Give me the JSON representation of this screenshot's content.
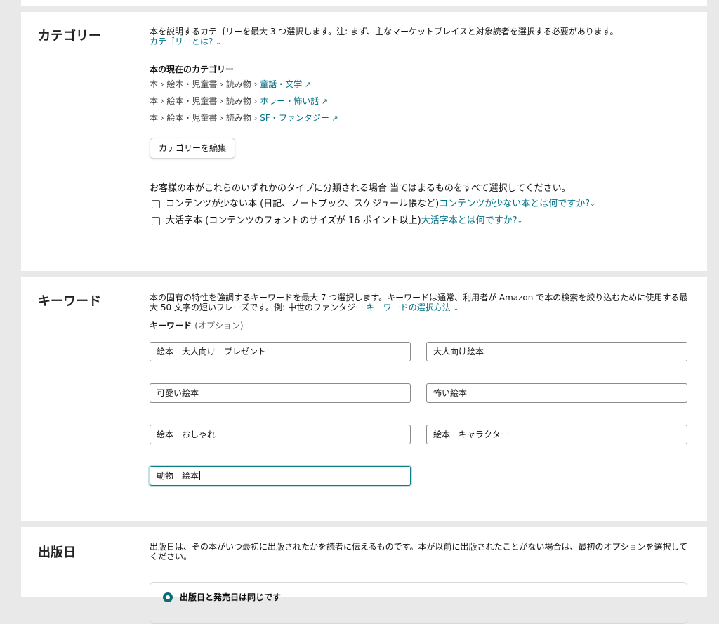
{
  "category": {
    "title": "カテゴリー",
    "description": "本を説明するカテゴリーを最大 3 つ選択します。注: まず、主なマーケットプレイスと対象読者を選択する必要があります。",
    "help_link": "カテゴリーとは?",
    "current_title": "本の現在のカテゴリー",
    "crumb_prefix": "本 › 絵本・児童書 › 読み物 › ",
    "items": [
      {
        "leaf": "童話・文学"
      },
      {
        "leaf": "ホラー・怖い話"
      },
      {
        "leaf": "SF・ファンタジー"
      }
    ],
    "edit_button": "カテゴリーを編集",
    "type_question": "お客様の本がこれらのいずれかのタイプに分類される場合 当てはまるものをすべて選択してください。",
    "checkboxes": [
      {
        "label": "コンテンツが少ない本 (日記、ノートブック、スケジュール帳など)",
        "link": "コンテンツが少ない本とは何ですか?",
        "checked": false
      },
      {
        "label": "大活字本 (コンテンツのフォントのサイズが 16 ポイント以上)",
        "link": "大活字本とは何ですか?",
        "checked": false
      }
    ]
  },
  "keywords": {
    "title": "キーワード",
    "description": "本の固有の特性を強調するキーワードを最大 7 つ選択します。キーワードは通常、利用者が Amazon で本の検索を絞り込むために使用する最大 50 文字の短いフレーズです。例: 中世のファンタジー",
    "help_link": "キーワードの選択方法",
    "label": "キーワード",
    "optional": "(オプション)",
    "values": [
      "絵本　大人向け　プレゼント",
      "大人向け絵本",
      "可愛い絵本",
      "怖い絵本",
      "絵本　おしゃれ",
      "絵本　キャラクター",
      "動物　絵本"
    ]
  },
  "pubdate": {
    "title": "出版日",
    "description": "出版日は、その本がいつ最初に出版されたかを読者に伝えるものです。本が以前に出版されたことがない場合は、最初のオプションを選択してください。",
    "option1": "出版日と発売日は同じです"
  },
  "colors": {
    "link": "#007185",
    "focus": "#0a7e86",
    "page_bg": "#e9e9e9"
  }
}
